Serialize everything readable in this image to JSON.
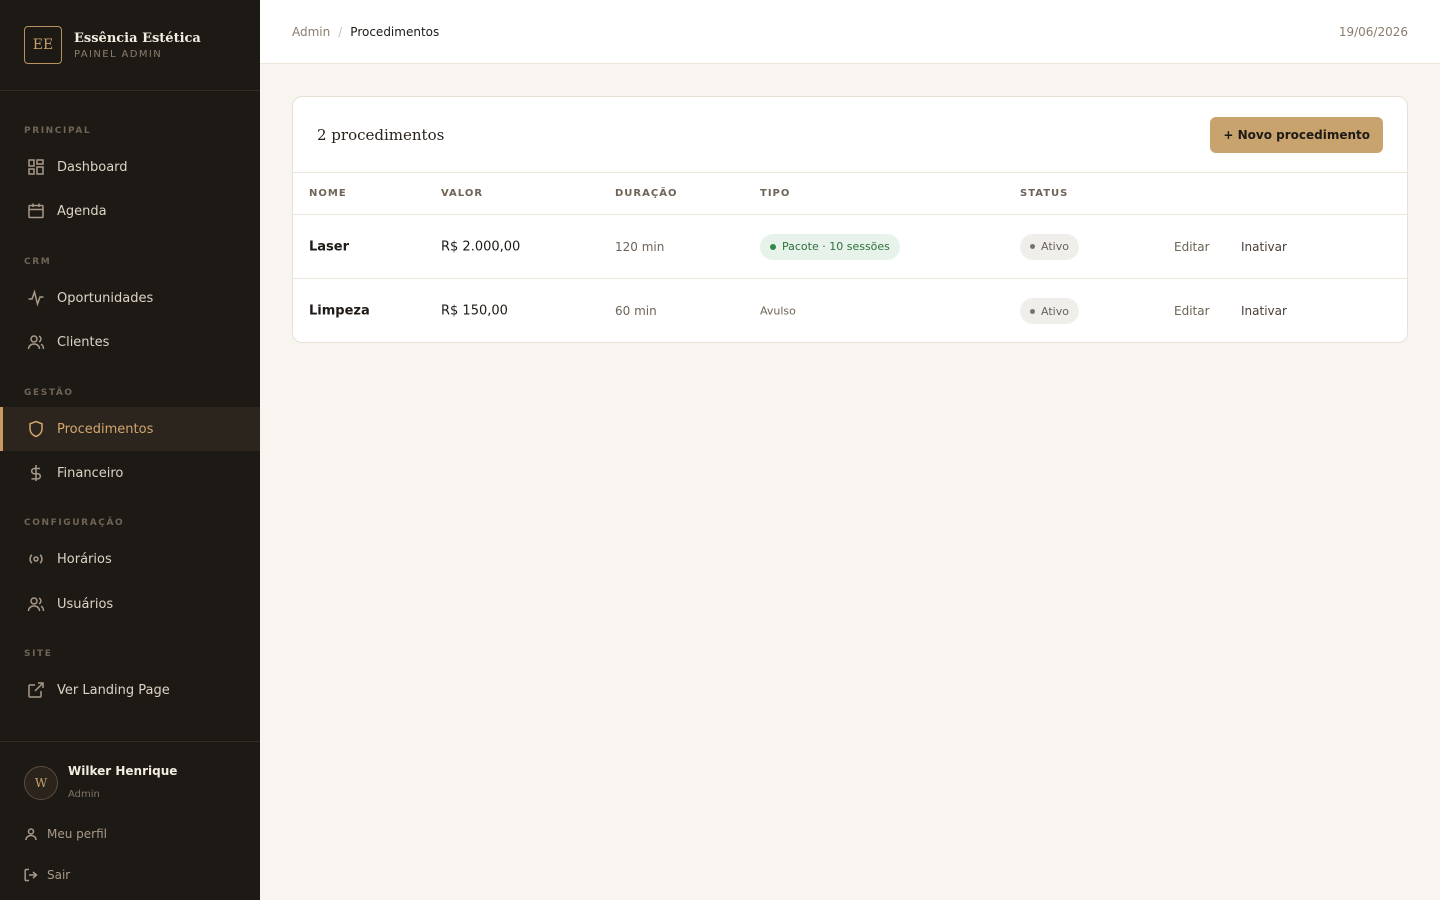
{
  "brand": {
    "initials": "EE",
    "name": "Essência Estética",
    "subtitle": "PAINEL ADMIN"
  },
  "sidebar": {
    "sections": [
      {
        "title": "PRINCIPAL"
      },
      {
        "title": "CRM"
      },
      {
        "title": "GESTÃO"
      },
      {
        "title": "CONFIGURAÇÃO"
      },
      {
        "title": "SITE"
      }
    ],
    "items": [
      {
        "label": "Dashboard",
        "icon": "grid-icon"
      },
      {
        "label": "Agenda",
        "icon": "calendar-icon"
      },
      {
        "label": "Oportunidades",
        "icon": "activity-icon"
      },
      {
        "label": "Clientes",
        "icon": "users-icon"
      },
      {
        "label": "Procedimentos",
        "icon": "shield-icon",
        "active": true
      },
      {
        "label": "Financeiro",
        "icon": "dollar-icon"
      },
      {
        "label": "Horários",
        "icon": "radio-icon"
      },
      {
        "label": "Usuários",
        "icon": "users-icon"
      },
      {
        "label": "Ver Landing Page",
        "icon": "external-link-icon"
      }
    ]
  },
  "user": {
    "initial": "W",
    "name": "Wilker Henrique",
    "role": "Admin",
    "profile_label": "Meu perfil",
    "logout_label": "Sair"
  },
  "header": {
    "breadcrumb_root": "Admin",
    "breadcrumb_sep": "/",
    "breadcrumb_current": "Procedimentos",
    "date": "19/06/2026"
  },
  "card": {
    "title": "2 procedimentos",
    "new_button": "+ Novo procedimento",
    "columns": [
      "NOME",
      "VALOR",
      "DURAÇÃO",
      "TIPO",
      "STATUS"
    ],
    "rows": [
      {
        "name": "Laser",
        "value": "R$ 2.000,00",
        "duration": "120 min",
        "type": "Pacote · 10 sessões",
        "status": "Ativo",
        "edit": "Editar",
        "deactivate": "Inativar"
      },
      {
        "name": "Limpeza",
        "value": "R$ 150,00",
        "duration": "60 min",
        "type": "Avulso",
        "status": "Ativo",
        "edit": "Editar",
        "deactivate": "Inativar"
      }
    ]
  },
  "colors": {
    "sidebar_bg": "#1d1915",
    "accent": "#c9a36e",
    "active_text": "#d2a66d",
    "page_bg": "#f8f5f0"
  }
}
